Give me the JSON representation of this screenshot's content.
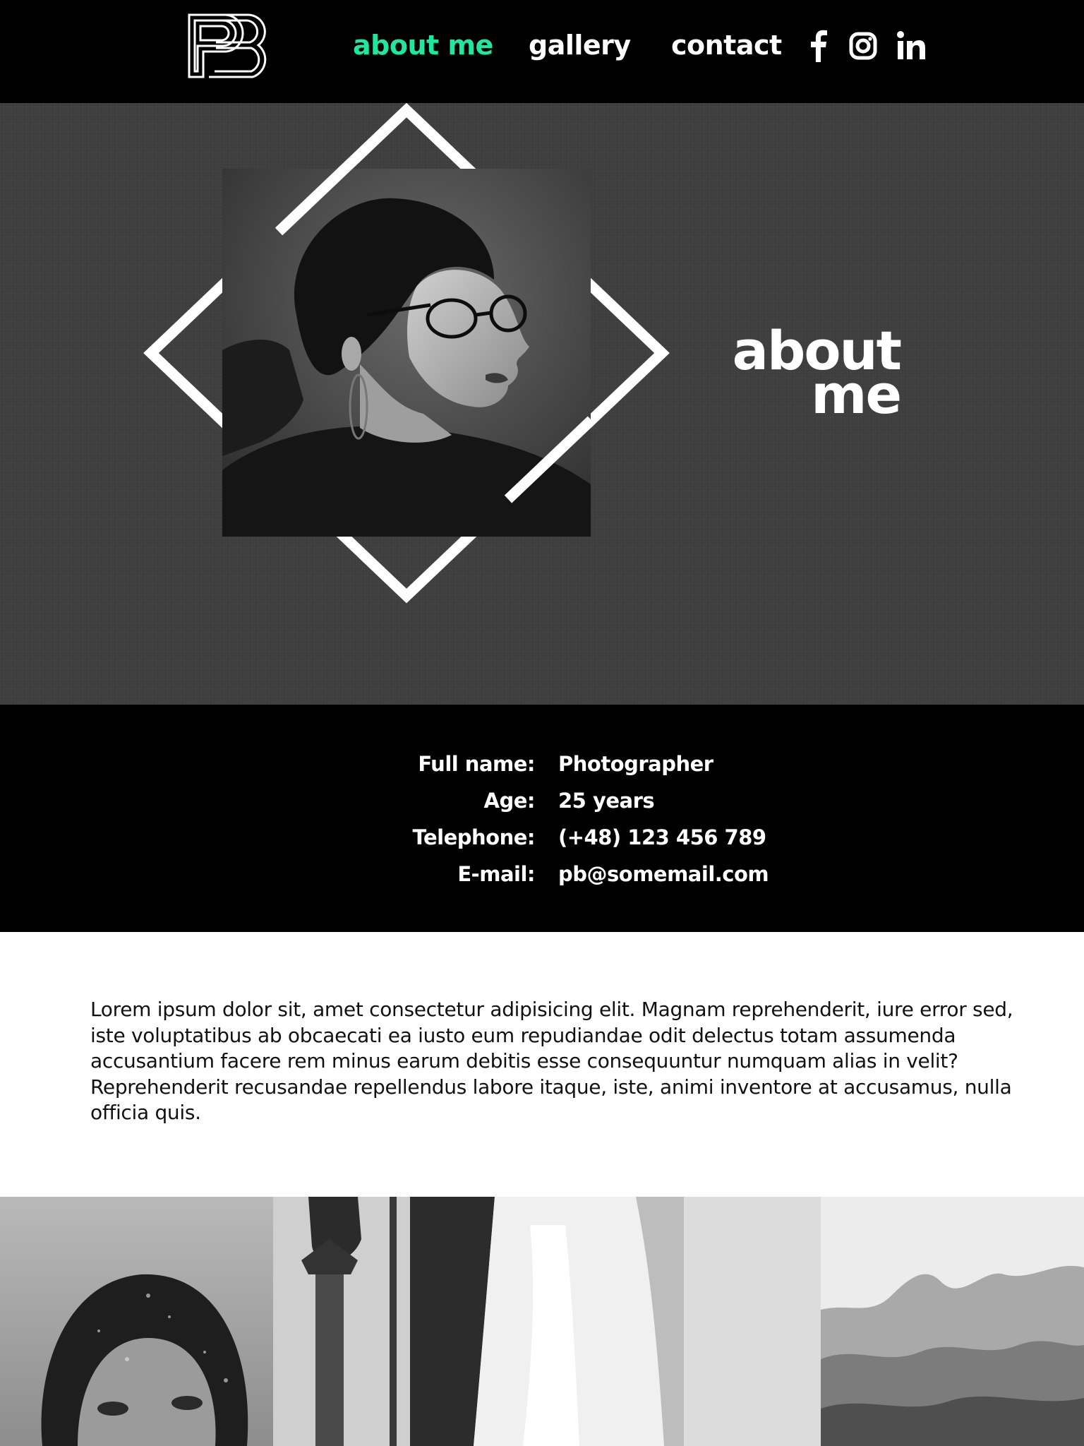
{
  "nav": {
    "logo_alt": "PB",
    "links": [
      {
        "label": "about me",
        "active": true
      },
      {
        "label": "gallery",
        "active": false
      },
      {
        "label": "contact",
        "active": false
      }
    ],
    "social": [
      "facebook-icon",
      "instagram-icon",
      "linkedin-icon"
    ],
    "accent_color": "#21e6a0"
  },
  "hero": {
    "title_line1": "about",
    "title_line2": "me"
  },
  "info": {
    "rows": [
      {
        "label": "Full name:",
        "value": "Photographer"
      },
      {
        "label": "Age:",
        "value": "25 years"
      },
      {
        "label": "Telephone:",
        "value": "(+48) 123 456 789"
      },
      {
        "label": "E-mail:",
        "value": "pb@somemail.com"
      }
    ]
  },
  "about": {
    "text": "Lorem ipsum dolor sit, amet consectetur adipisicing elit. Magnam reprehenderit, iure error sed, iste voluptatibus ab obcaecati ea iusto eum repudiandae odit delectus totam assumenda accusantium facere rem minus earum debitis esse consequuntur numquam alias in velit? Reprehenderit recusandae repellendus labore itaque, iste, animi inventore at accusamus, nulla officia quis."
  },
  "gallery": {
    "images": [
      "portrait-rain-photo",
      "palm-tree-photo",
      "waterfall-photo",
      "blank-sky-photo",
      "mountains-photo"
    ]
  }
}
